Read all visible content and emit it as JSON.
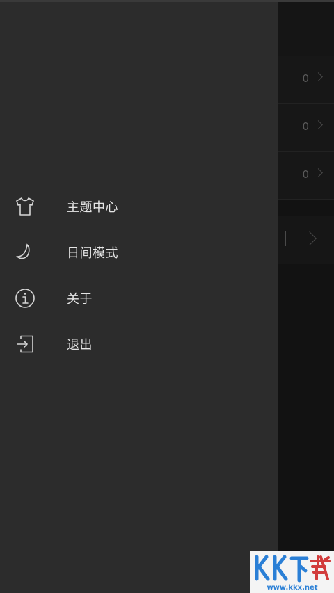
{
  "background": {
    "rows": [
      {
        "count": "0"
      },
      {
        "count": "0"
      },
      {
        "count": "0"
      }
    ]
  },
  "drawer": {
    "items": [
      {
        "label": "主题中心",
        "icon": "tshirt-icon"
      },
      {
        "label": "日间模式",
        "icon": "moon-icon"
      },
      {
        "label": "关于",
        "icon": "info-icon"
      },
      {
        "label": "退出",
        "icon": "logout-icon"
      }
    ]
  },
  "watermark": {
    "logo_text": "KK下载",
    "domain": "www.kkx.net"
  },
  "colors": {
    "drawer_bg": "#2c2c2c",
    "app_bg": "#141414",
    "text": "#e6e6e6",
    "icon": "#d6d6d6",
    "watermark_blue": "#2a7fd6",
    "watermark_red": "#d23c3c"
  }
}
